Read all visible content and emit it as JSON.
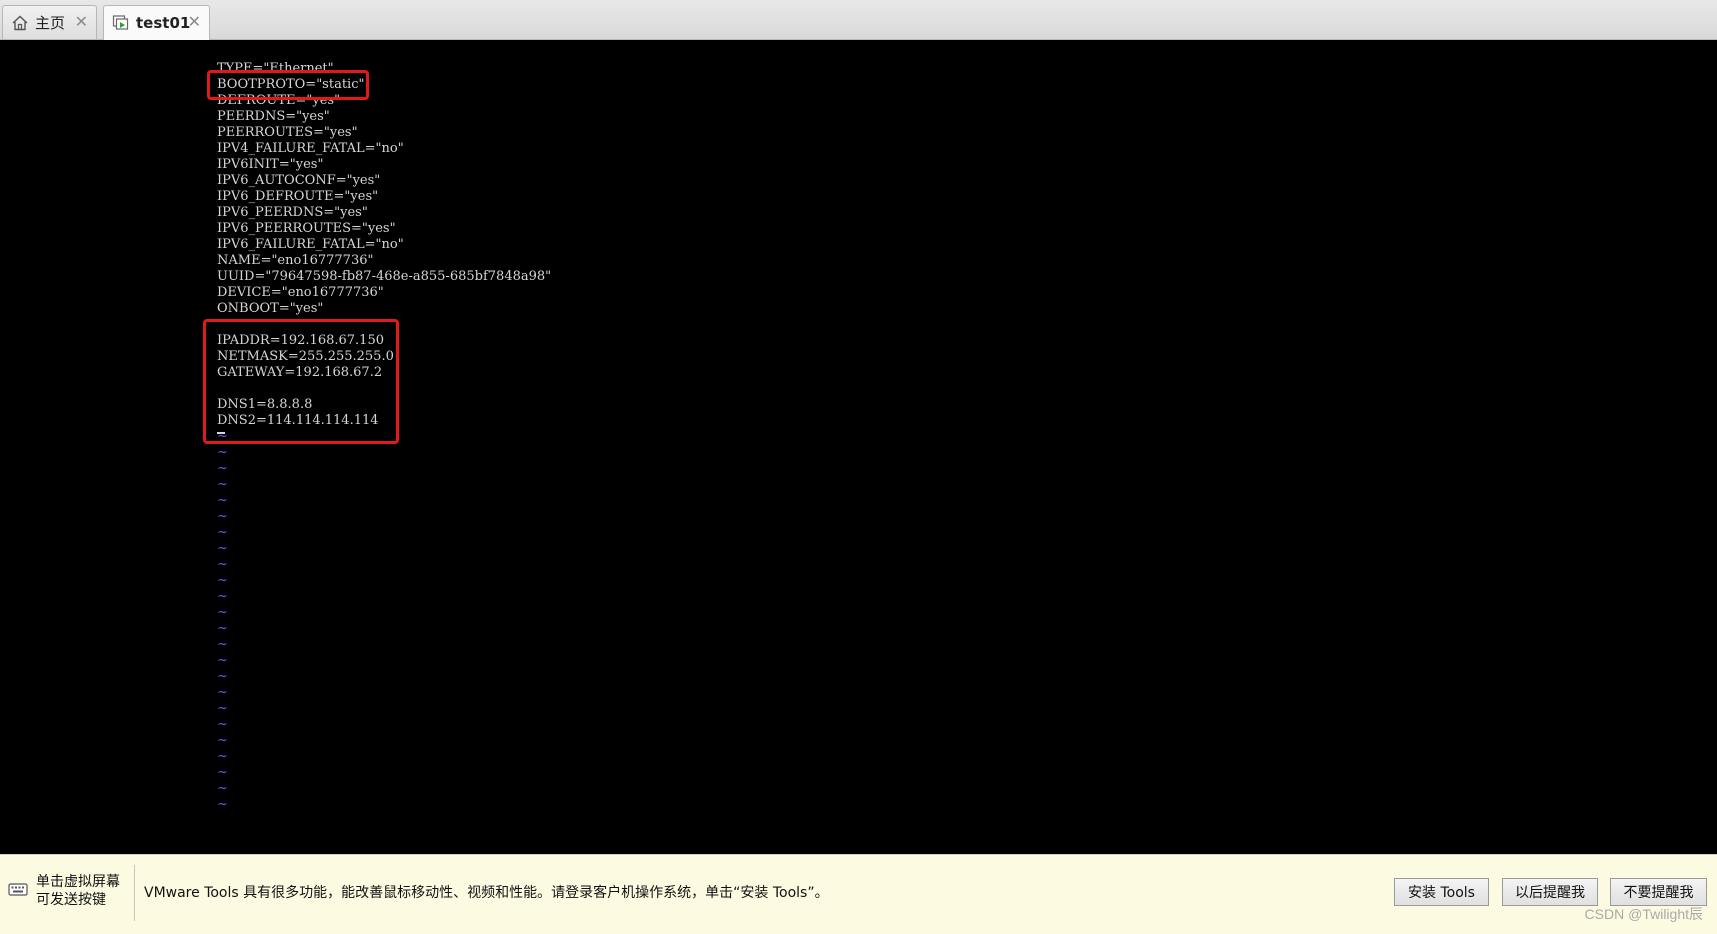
{
  "tabs": [
    {
      "label": "主页",
      "icon": "home-icon"
    },
    {
      "label": "test01",
      "icon": "vm-icon",
      "active": true
    }
  ],
  "terminal": {
    "lines": [
      "TYPE=\"Ethernet\"",
      "BOOTPROTO=\"static\"",
      "DEFROUTE=\"yes\"",
      "PEERDNS=\"yes\"",
      "PEERROUTES=\"yes\"",
      "IPV4_FAILURE_FATAL=\"no\"",
      "IPV6INIT=\"yes\"",
      "IPV6_AUTOCONF=\"yes\"",
      "IPV6_DEFROUTE=\"yes\"",
      "IPV6_PEERDNS=\"yes\"",
      "IPV6_PEERROUTES=\"yes\"",
      "IPV6_FAILURE_FATAL=\"no\"",
      "NAME=\"eno16777736\"",
      "UUID=\"79647598-fb87-468e-a855-685bf7848a98\"",
      "DEVICE=\"eno16777736\"",
      "ONBOOT=\"yes\"",
      "",
      "IPADDR=192.168.67.150",
      "NETMASK=255.255.255.0",
      "GATEWAY=192.168.67.2",
      "",
      "DNS1=8.8.8.8",
      "DNS2=114.114.114.114"
    ],
    "empty_marker": "~",
    "empty_line_count": 24,
    "text_color": "#d6d6d6",
    "tilde_color": "#5a5af0",
    "highlight_color": "#e0191a"
  },
  "tools_bar": {
    "hint_line1": "单击虚拟屏幕",
    "hint_line2": "可发送按键",
    "message": "VMware Tools 具有很多功能，能改善鼠标移动性、视频和性能。请登录客户机操作系统，单击“安装 Tools”。",
    "install_button": "安装 Tools",
    "later_button": "以后提醒我",
    "never_button": "不要提醒我"
  },
  "watermark": "CSDN @Twilight辰"
}
